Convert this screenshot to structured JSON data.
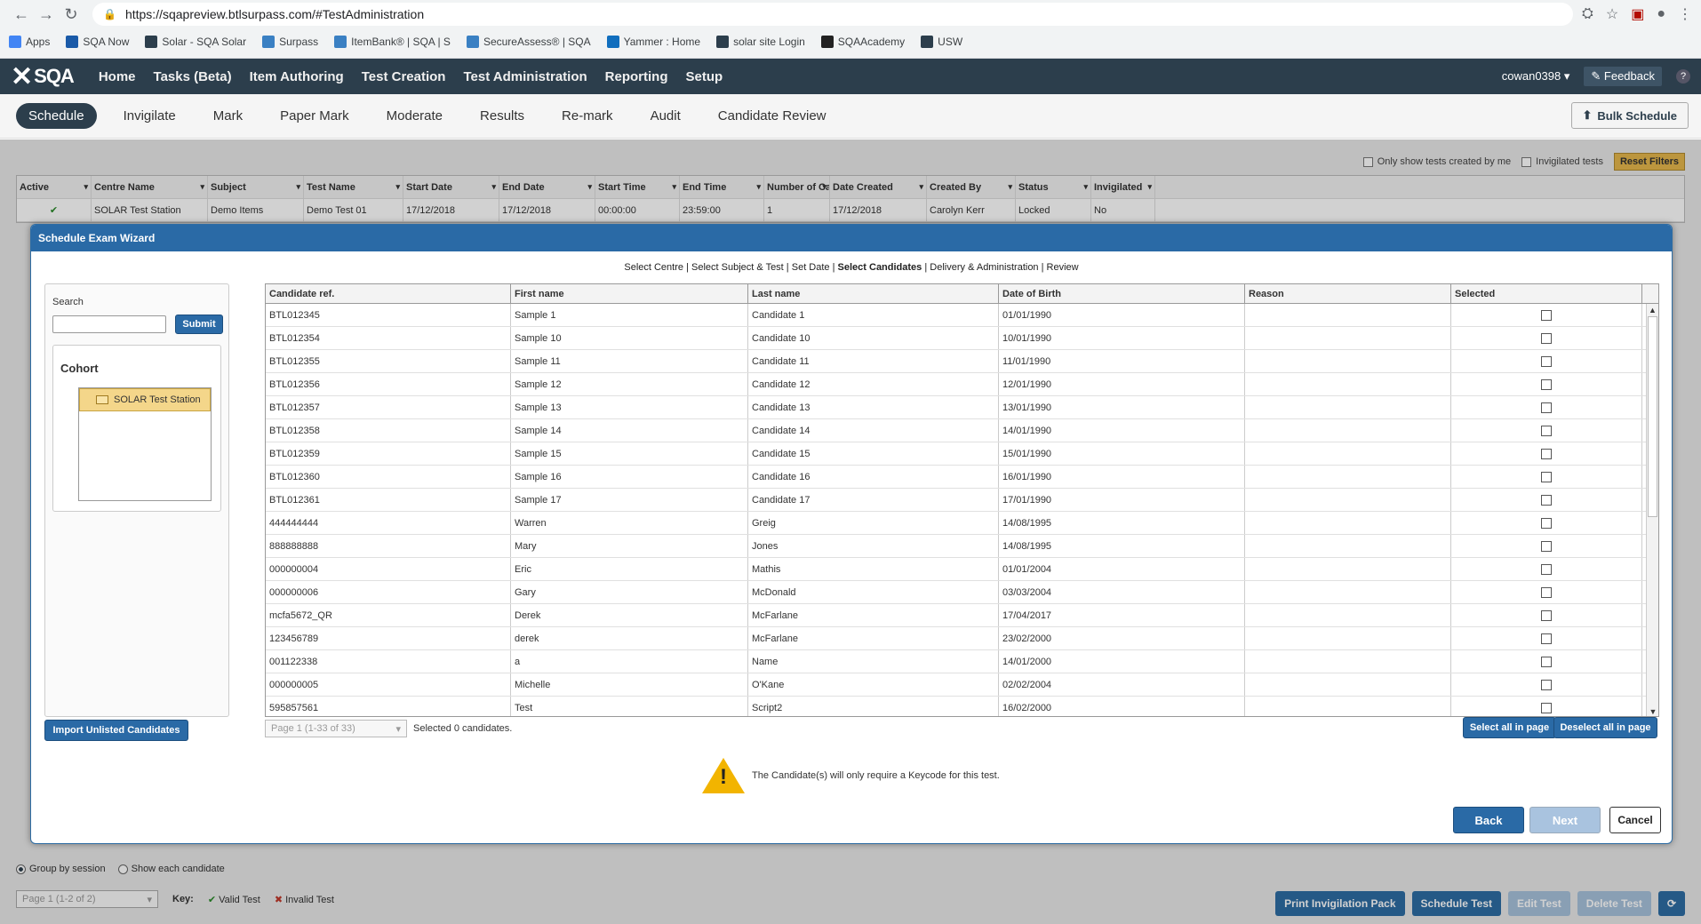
{
  "browser": {
    "url": "https://sqapreview.btlsurpass.com/#TestAdministration",
    "bookmarks": [
      {
        "label": "Apps",
        "icon": "apps-grid-icon",
        "color": "#4285f4"
      },
      {
        "label": "SQA Now",
        "icon": "sqa-icon",
        "color": "#1a5aa8"
      },
      {
        "label": "Solar - SQA Solar",
        "icon": "solar-icon",
        "color": "#2c3e4c"
      },
      {
        "label": "Surpass",
        "icon": "surpass-icon",
        "color": "#3a80c3"
      },
      {
        "label": "ItemBank® | SQA | S",
        "icon": "itembank-icon",
        "color": "#3a80c3"
      },
      {
        "label": "SecureAssess® | SQA",
        "icon": "secureassess-icon",
        "color": "#3a80c3"
      },
      {
        "label": "Yammer : Home",
        "icon": "yammer-icon",
        "color": "#106ebe"
      },
      {
        "label": "solar site Login",
        "icon": "solar-icon",
        "color": "#2c3e4c"
      },
      {
        "label": "SQAAcademy",
        "icon": "academy-icon",
        "color": "#222"
      },
      {
        "label": "USW",
        "icon": "usw-icon",
        "color": "#2c3e4c"
      }
    ]
  },
  "topnav": {
    "logo": "SQA",
    "menu": [
      "Home",
      "Tasks (Beta)",
      "Item Authoring",
      "Test Creation",
      "Test Administration",
      "Reporting",
      "Setup"
    ],
    "user": "cowan0398",
    "feedback": "Feedback",
    "help": "?"
  },
  "subnav": {
    "tabs": [
      "Schedule",
      "Invigilate",
      "Mark",
      "Paper Mark",
      "Moderate",
      "Results",
      "Re-mark",
      "Audit",
      "Candidate Review"
    ],
    "bulk_schedule": "Bulk Schedule"
  },
  "background": {
    "only_mine": "Only show tests created by me",
    "invigilated": "Invigilated tests",
    "reset_filters": "Reset Filters",
    "columns": [
      "Active",
      "Centre Name",
      "Subject",
      "Test Name",
      "Start Date",
      "End Date",
      "Start Time",
      "End Time",
      "Number of Candi...",
      "Date Created",
      "Created By",
      "Status",
      "Invigilated"
    ],
    "row": [
      "✔",
      "SOLAR Test Station",
      "Demo Items",
      "Demo Test 01",
      "17/12/2018",
      "17/12/2018",
      "00:00:00",
      "23:59:00",
      "1",
      "17/12/2018",
      "Carolyn Kerr",
      "Locked",
      "No"
    ],
    "group_by_session": "Group by session",
    "show_each_candidate": "Show each candidate",
    "pager": "Page 1 (1-2 of 2)",
    "key": "Key:",
    "valid_test": "Valid Test",
    "invalid_test": "Invalid Test",
    "buttons": {
      "print": "Print Invigilation Pack",
      "schedule": "Schedule Test",
      "edit": "Edit Test",
      "delete": "Delete Test"
    }
  },
  "wizard": {
    "title": "Schedule Exam Wizard",
    "steps": {
      "s1": "Select Centre",
      "s2": "Select Subject & Test",
      "s3": "Set Date",
      "s4": "Select Candidates",
      "s5": "Delivery & Administration",
      "s6": "Review"
    },
    "search_label": "Search",
    "submit": "Submit",
    "cohort_title": "Cohort",
    "cohort_item": "SOLAR Test Station",
    "columns": [
      "Candidate ref.",
      "First name",
      "Last name",
      "Date of Birth",
      "Reason",
      "Selected"
    ],
    "rows": [
      [
        "BTL012345",
        "Sample 1",
        "Candidate 1",
        "01/01/1990",
        ""
      ],
      [
        "BTL012354",
        "Sample 10",
        "Candidate 10",
        "10/01/1990",
        ""
      ],
      [
        "BTL012355",
        "Sample 11",
        "Candidate 11",
        "11/01/1990",
        ""
      ],
      [
        "BTL012356",
        "Sample 12",
        "Candidate 12",
        "12/01/1990",
        ""
      ],
      [
        "BTL012357",
        "Sample 13",
        "Candidate 13",
        "13/01/1990",
        ""
      ],
      [
        "BTL012358",
        "Sample 14",
        "Candidate 14",
        "14/01/1990",
        ""
      ],
      [
        "BTL012359",
        "Sample 15",
        "Candidate 15",
        "15/01/1990",
        ""
      ],
      [
        "BTL012360",
        "Sample 16",
        "Candidate 16",
        "16/01/1990",
        ""
      ],
      [
        "BTL012361",
        "Sample 17",
        "Candidate 17",
        "17/01/1990",
        ""
      ],
      [
        "444444444",
        "Warren",
        "Greig",
        "14/08/1995",
        ""
      ],
      [
        "888888888",
        "Mary",
        "Jones",
        "14/08/1995",
        ""
      ],
      [
        "000000004",
        "Eric",
        "Mathis",
        "01/01/2004",
        ""
      ],
      [
        "000000006",
        "Gary",
        "McDonald",
        "03/03/2004",
        ""
      ],
      [
        "mcfa5672_QR",
        "Derek",
        "McFarlane",
        "17/04/2017",
        ""
      ],
      [
        "123456789",
        "derek",
        "McFarlane",
        "23/02/2000",
        ""
      ],
      [
        "001122338",
        "a",
        "Name",
        "14/01/2000",
        ""
      ],
      [
        "000000005",
        "Michelle",
        "O'Kane",
        "02/02/2004",
        ""
      ],
      [
        "595857561",
        "Test",
        "Script2",
        "16/02/2000",
        ""
      ]
    ],
    "import_unlisted": "Import Unlisted Candidates",
    "pager": "Page 1 (1-33 of 33)",
    "selected_count": "Selected 0 candidates.",
    "select_all": "Select all in page",
    "deselect_all": "Deselect all in page",
    "warning": "The Candidate(s) will only require a Keycode for this test.",
    "back": "Back",
    "next": "Next",
    "cancel": "Cancel"
  }
}
